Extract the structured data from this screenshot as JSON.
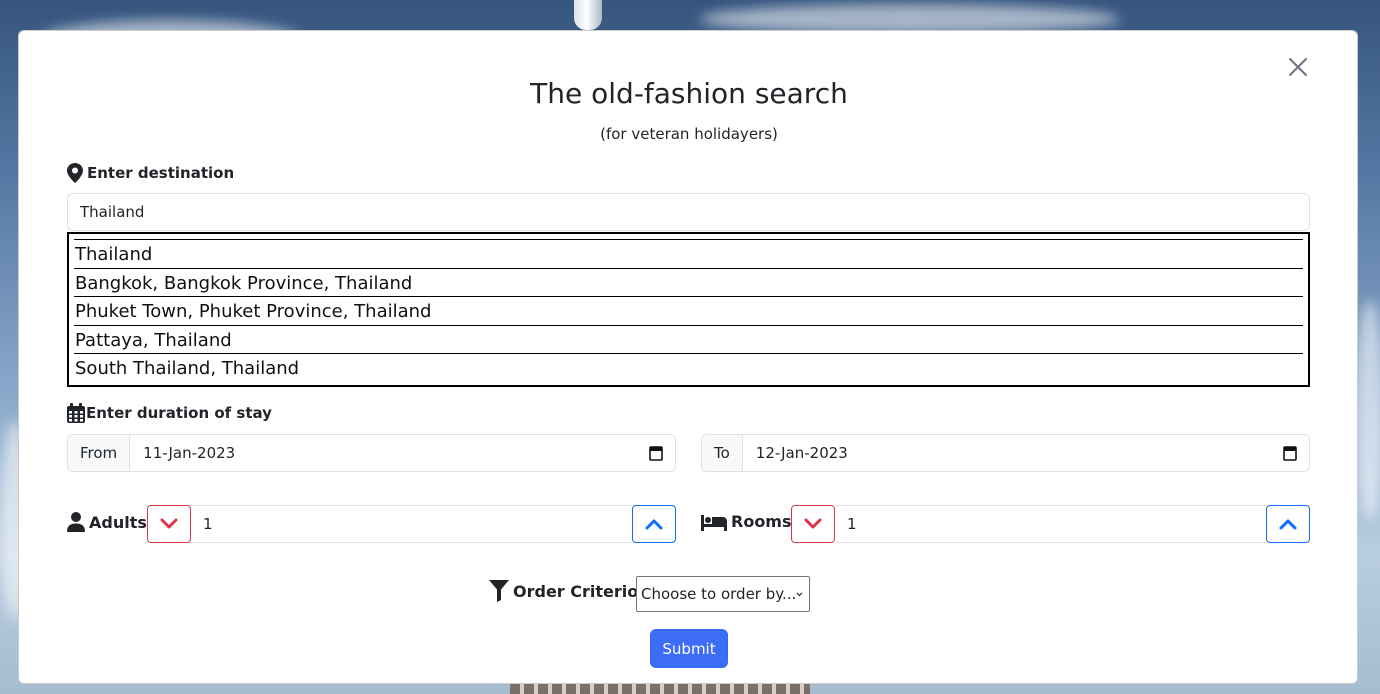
{
  "modal": {
    "title": "The old-fashion search",
    "subtitle": "(for veteran holidayers)"
  },
  "destination": {
    "label": "Enter destination",
    "value": "Thailand",
    "suggestions": [
      "Thailand",
      "Bangkok, Bangkok Province, Thailand",
      "Phuket Town, Phuket Province, Thailand",
      "Pattaya, Thailand",
      "South Thailand, Thailand"
    ]
  },
  "duration": {
    "label": "Enter duration of stay",
    "from_label": "From",
    "from_value": "11-Jan-2023",
    "to_label": "To",
    "to_value": "12-Jan-2023"
  },
  "adults": {
    "label": "Adults -",
    "value": "1"
  },
  "rooms": {
    "label": "Rooms -",
    "value": "1"
  },
  "order": {
    "label": "Order Criterion -",
    "selected": "Choose to order by..."
  },
  "submit_label": "Submit",
  "colors": {
    "primary": "#3d6df6",
    "danger": "#dc3545",
    "up_border": "#0d6efd"
  }
}
